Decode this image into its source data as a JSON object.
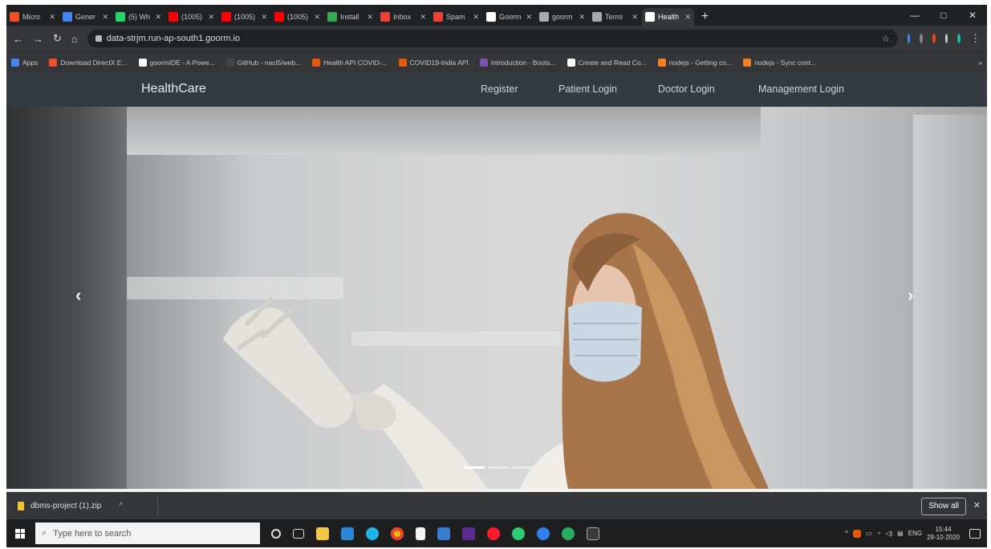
{
  "browser": {
    "tabs": [
      {
        "title": "Micro",
        "color": "#f25022"
      },
      {
        "title": "Gener",
        "color": "#4285f4"
      },
      {
        "title": "(5) Wh",
        "color": "#25d366"
      },
      {
        "title": "(1005)",
        "color": "#ff0000"
      },
      {
        "title": "(1005)",
        "color": "#ff0000"
      },
      {
        "title": "(1005)",
        "color": "#ff0000"
      },
      {
        "title": "Install",
        "color": "#34a853"
      },
      {
        "title": "Inbox",
        "color": "#ea4335"
      },
      {
        "title": "Spam",
        "color": "#ea4335"
      },
      {
        "title": "Goorm",
        "color": "#ffffff"
      },
      {
        "title": "goorm",
        "color": "#aaaaaa"
      },
      {
        "title": "Termi",
        "color": "#aaaaaa"
      },
      {
        "title": "Health",
        "color": "#ffffff",
        "active": true
      }
    ],
    "new_tab": "+",
    "url": "data-strjm.run-ap-south1.goorm.io",
    "bookmarks": [
      {
        "label": "Apps",
        "color": "#4285f4"
      },
      {
        "label": "Download DirectX E...",
        "color": "#f25022"
      },
      {
        "label": "goormIDE - A Powe...",
        "color": "#ffffff"
      },
      {
        "label": "GitHub - nacl5/web...",
        "color": "#444444"
      },
      {
        "label": "Health API COVID-...",
        "color": "#e8590c"
      },
      {
        "label": "COVID19-India API",
        "color": "#e8590c"
      },
      {
        "label": "Introduction · Boots...",
        "color": "#7952b3"
      },
      {
        "label": "Create and Read Co...",
        "color": "#ffffff"
      },
      {
        "label": "nodejs - Getting co...",
        "color": "#f48024"
      },
      {
        "label": "nodejs - Sync cont...",
        "color": "#f48024"
      }
    ]
  },
  "site": {
    "brand": "HealthCare",
    "nav": [
      "Register",
      "Patient Login",
      "Doctor Login",
      "Management Login"
    ],
    "carousel": {
      "prev": "‹",
      "next": "›",
      "slide_count": 3,
      "active_index": 0
    }
  },
  "downloads": {
    "file": "dbms-project (1).zip",
    "show_all": "Show all"
  },
  "taskbar": {
    "search_placeholder": "Type here to search",
    "language": "ENG",
    "time": "15:44",
    "date": "29-10-2020"
  }
}
